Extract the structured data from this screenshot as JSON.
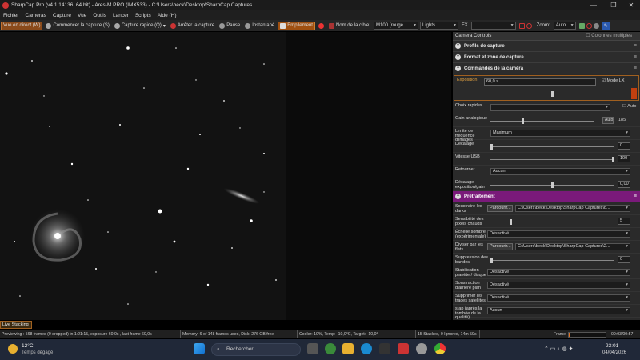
{
  "title": "SharpCap Pro (v4.1.14136, 64 bit) - Ares-M PRO (IMX533) - C:\\Users\\beck\\Desktop\\SharpCap Captures",
  "window_controls": [
    "—",
    "❐",
    "✕"
  ],
  "menu": [
    "Fichier",
    "Caméras",
    "Capture",
    "Vue",
    "Outils",
    "Lancer",
    "Scripts",
    "Aide (H)"
  ],
  "toolbar": {
    "live": "Vue en direct (W)",
    "start_capture": "Commencer la capture (S)",
    "quick_capture": "Capture rapide (Q)",
    "stop_capture": "Arrêter la capture",
    "pause": "Pause",
    "snapshot": "Instantané",
    "stack": "Empilement",
    "target_label": "Nom de la cible:",
    "target_value": "M100 (rouge",
    "frame_type": "Lights",
    "fx_label": "FX",
    "fx_value": "",
    "zoom_label": "Zoom:",
    "zoom_value": "Auto"
  },
  "panel": {
    "header": "Camera Controls",
    "multi_columns": "Colonnes multiples",
    "sections": {
      "profiles": "Profils de capture",
      "format": "Format et zone de capture",
      "camera": "Commandes de la caméra",
      "preprocessing": "Prétraitement"
    },
    "exposure": {
      "label": "Exposition",
      "value": "60,0 s",
      "mode_lx": "Mode LX"
    },
    "quick_choice": {
      "label": "Choix rapides",
      "auto": "Auto"
    },
    "gain": {
      "label": "Gain analogique",
      "auto": "Auto",
      "value": "185",
      "level_fraction": 0.31
    },
    "frame_rate": {
      "label": "Limite de fréquence d'images",
      "value": "Maximum"
    },
    "offset": {
      "label": "Décalage",
      "value": "0"
    },
    "usb_speed": {
      "label": "Vitesse USB",
      "value": "100"
    },
    "flip": {
      "label": "Retourner",
      "value": "Aucun"
    },
    "exp_gain_offset": {
      "label": "Décalage exposition/gain",
      "value": "0,00"
    },
    "dark": {
      "label": "Soustraire les darks",
      "browse": "Parcourir...",
      "path": "C:\\Users\\beck\\Desktop\\SharpCap Captures\\d..."
    },
    "hot_pixel": {
      "label": "Sensibilité des pixels chauds",
      "value": "5"
    },
    "dark_scale": {
      "label": "Échelle sombre (expérimentale)",
      "value": "Désactivé"
    },
    "flat": {
      "label": "Diviser par les flats",
      "browse": "Parcourir...",
      "path": "C:\\Users\\beck\\Desktop\\SharpCap Captures\\2..."
    },
    "banding": {
      "label": "Suppression des bandes",
      "value": "0"
    },
    "stabilization": {
      "label": "Stabilisation planète / disque",
      "value": "Désactivé"
    },
    "background": {
      "label": "Soustraction d'arrière plan",
      "value": "Désactivé"
    },
    "satellite": {
      "label": "Supprimer les traces satellites",
      "value": "Désactivé"
    },
    "quality": {
      "label": "s ap (après la tombée de la qualité)",
      "value": "Aucun"
    }
  },
  "live_stacking": "Live Stacking",
  "status": {
    "preview": "Previewing : 568 frames (0 dropped) in 1:21:15, exposure 60,0s , last frame 60,0s",
    "memory": "Memory: 6 of 148 frames used, Disk: 276 GB free",
    "cooler": "Cooler: 10%, Temp: -10,0°C, Target: -10,0°",
    "stacked": "15 Stacked, 0 Ignored, 14m 59s",
    "frame_label": "Frame",
    "time": "00:03/00:57",
    "frame_progress": 0.05
  },
  "taskbar": {
    "temp": "12°C",
    "weather": "Temps dégagé",
    "search": "Rechercher",
    "clock": "23:01",
    "date": "04/04/2026"
  },
  "colors": {
    "accent": "#c07030",
    "preprocess": "#7a1a7a",
    "orange_text": "#e0a040"
  }
}
